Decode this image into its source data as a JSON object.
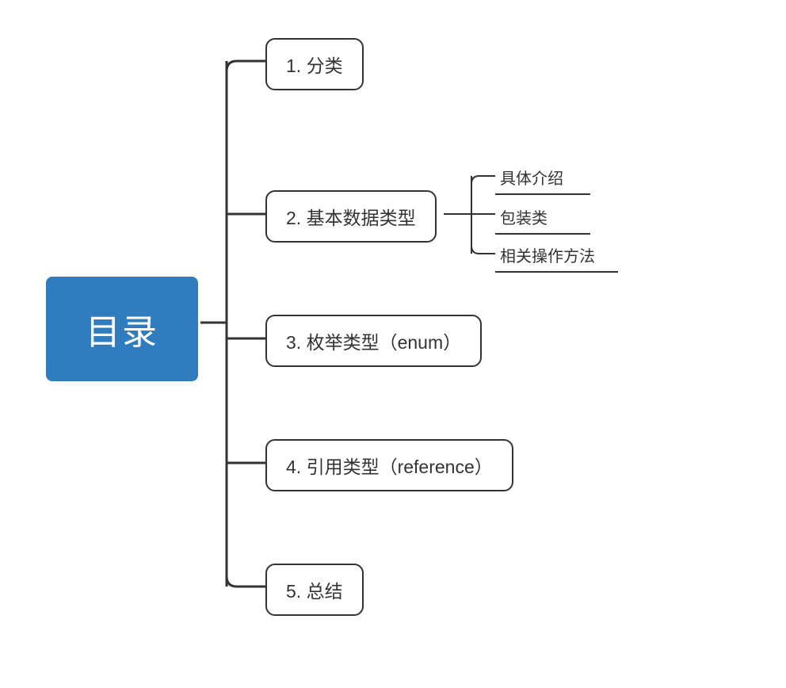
{
  "root": {
    "label": "目录"
  },
  "branches": [
    {
      "label": "1. 分类"
    },
    {
      "label": "2. 基本数据类型"
    },
    {
      "label": "3. 枚举类型（enum）"
    },
    {
      "label": "4. 引用类型（reference）"
    },
    {
      "label": "5. 总结"
    }
  ],
  "branch2_children": [
    {
      "label": "具体介绍"
    },
    {
      "label": "包装类"
    },
    {
      "label": "相关操作方法"
    }
  ],
  "colors": {
    "root_bg": "#2F7CBF",
    "root_fg": "#FFFFFF",
    "stroke": "#333333"
  }
}
